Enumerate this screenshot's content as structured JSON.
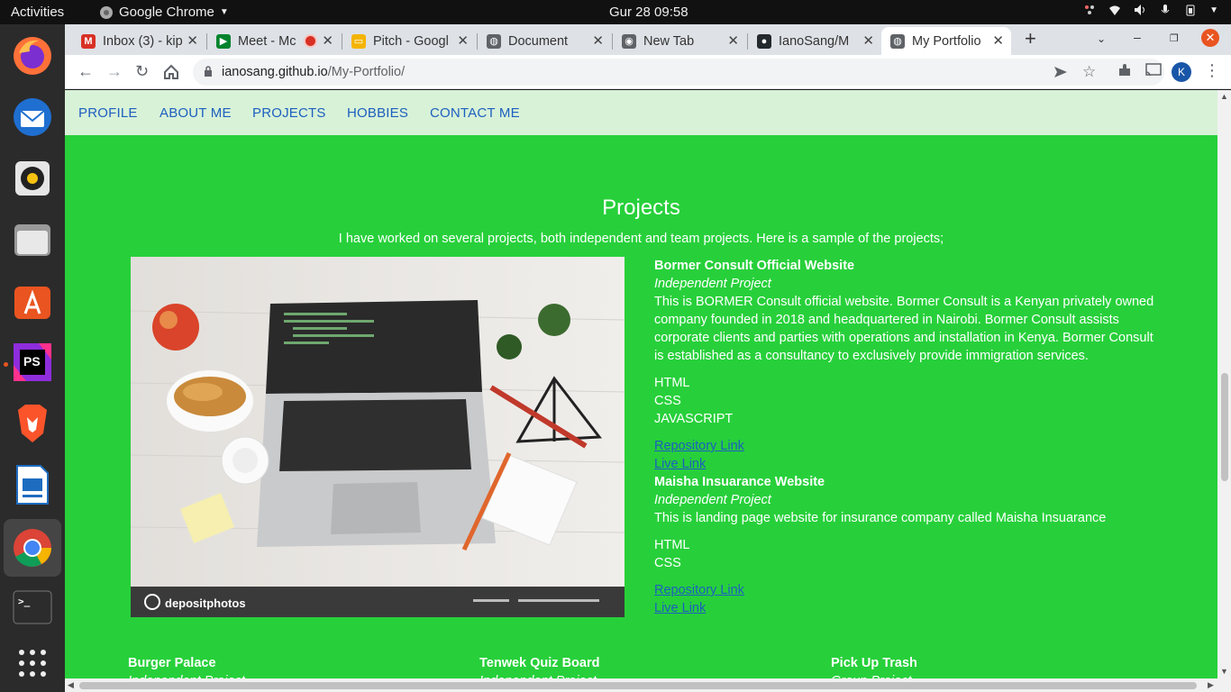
{
  "system_bar": {
    "activities": "Activities",
    "app_name": "Google Chrome",
    "clock": "Gur 28  09:58",
    "tray_icons": [
      "color-picker-icon",
      "wifi-icon",
      "volume-icon",
      "microphone-icon",
      "battery-icon",
      "power-menu-icon"
    ]
  },
  "dock": {
    "apps": [
      {
        "name": "firefox",
        "icon": "firefox-icon",
        "color": "#ff7139"
      },
      {
        "name": "thunderbird",
        "icon": "thunderbird-icon",
        "color": "#1f6fd1"
      },
      {
        "name": "rhythmbox",
        "icon": "rhythmbox-icon",
        "color": "#e0e0e0"
      },
      {
        "name": "files",
        "icon": "files-icon",
        "color": "#9e9e9e"
      },
      {
        "name": "software",
        "icon": "software-center-icon",
        "color": "#e95420"
      },
      {
        "name": "phpstorm",
        "icon": "phpstorm-icon",
        "color": "#8e2ddc",
        "label": "PS"
      },
      {
        "name": "brave",
        "icon": "brave-icon",
        "color": "#fb542b"
      },
      {
        "name": "writer",
        "icon": "libreoffice-writer-icon",
        "color": "#1e6cc0"
      },
      {
        "name": "chrome",
        "icon": "chrome-icon",
        "color": "#34a853"
      },
      {
        "name": "terminal",
        "icon": "terminal-icon",
        "color": "#2c2c2c",
        "label": ">_"
      },
      {
        "name": "show-apps",
        "icon": "app-grid-icon",
        "color": "#2b2b2b"
      }
    ]
  },
  "browser": {
    "tabs": [
      {
        "title": "Inbox (3) - kip",
        "favicon": "gmail-icon",
        "color": "#d93025",
        "glyph": "M"
      },
      {
        "title": "Meet - Mc",
        "favicon": "google-meet-icon",
        "color": "#00832d",
        "glyph": "▶",
        "recording": true
      },
      {
        "title": "Pitch - Googl",
        "favicon": "google-slides-icon",
        "color": "#f4b400",
        "glyph": "▭"
      },
      {
        "title": "Document",
        "favicon": "globe-icon",
        "color": "#5f6368",
        "glyph": "◍"
      },
      {
        "title": "New Tab",
        "favicon": "chrome-icon",
        "color": "#5f6368",
        "glyph": "◉"
      },
      {
        "title": "IanoSang/M",
        "favicon": "github-icon",
        "color": "#24292e",
        "glyph": "●"
      },
      {
        "title": "My Portfolio",
        "favicon": "globe-icon",
        "color": "#5f6368",
        "glyph": "◍",
        "active": true
      }
    ],
    "new_tab_label": "+",
    "url_host": "ianosang.github.io",
    "url_path": "/My-Portfolio/",
    "profile_initial": "K"
  },
  "page": {
    "nav": [
      "PROFILE",
      "ABOUT ME",
      "PROJECTS",
      "HOBBIES",
      "CONTACT ME"
    ],
    "title": "Projects",
    "intro": "I have worked on several projects, both independent and team projects. Here is a sample of the projects;",
    "image_caption": "depositphotos",
    "projects": [
      {
        "name": "Bormer Consult Official Website",
        "type": "Independent Project",
        "description": "This is BORMER Consult official website. Bormer Consult is a Kenyan privately owned company founded in 2018 and headquartered in Nairobi. Bormer Consult assists corporate clients and parties with operations and installation in Kenya. Bormer Consult is established as a consultancy to exclusively provide immigration services.",
        "tech": [
          "HTML",
          "CSS",
          "JAVASCRIPT"
        ],
        "repo_label": "Repository Link",
        "live_label": "Live Link"
      },
      {
        "name": "Maisha Insuarance Website",
        "type": "Independent Project",
        "description": "This is landing page website for insurance company called Maisha Insuarance",
        "tech": [
          "HTML",
          "CSS"
        ],
        "repo_label": "Repository Link",
        "live_label": "Live Link"
      }
    ],
    "more_projects": [
      {
        "name": "Burger Palace",
        "type": "Independent Project"
      },
      {
        "name": "Tenwek Quiz Board",
        "type": "Independent Project"
      },
      {
        "name": "Pick Up Trash",
        "type": "Group Project"
      }
    ],
    "colors": {
      "page_bg": "#27d03a",
      "nav_bg": "#d8f2d8",
      "link": "#1d5fbf"
    }
  }
}
